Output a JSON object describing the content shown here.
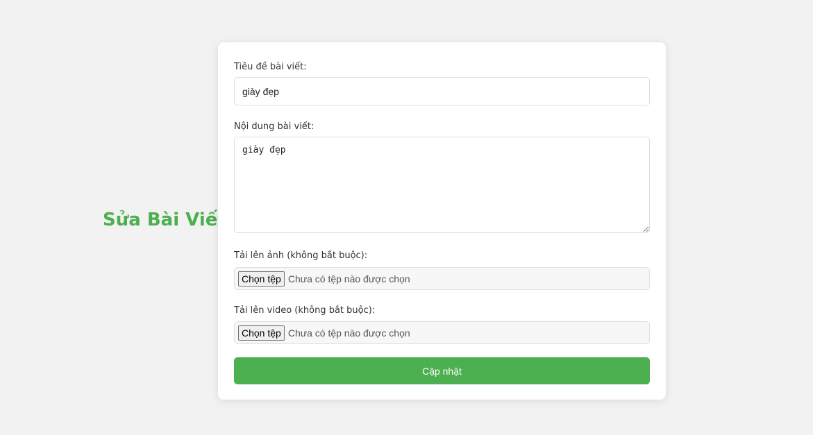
{
  "page": {
    "heading": "Sửa Bài Viết",
    "accent_color": "#4caf50"
  },
  "form": {
    "title_field": {
      "label": "Tiêu đề bài viết:",
      "value": "giày đẹp"
    },
    "content_field": {
      "label": "Nội dung bài viết:",
      "value": "giày đẹp"
    },
    "image_upload": {
      "label": "Tải lên ảnh (không bắt buộc):",
      "button_label": "Chọn tệp",
      "status": "Chưa có tệp nào được chọn"
    },
    "video_upload": {
      "label": "Tải lên video (không bắt buộc):",
      "button_label": "Chọn tệp",
      "status": "Chưa có tệp nào được chọn"
    },
    "submit_label": "Cập nhật"
  }
}
